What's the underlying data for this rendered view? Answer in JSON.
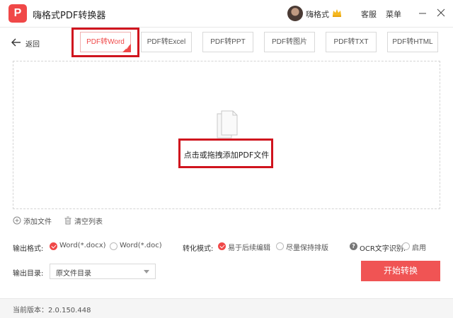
{
  "titlebar": {
    "logo_letter": "P",
    "app_title": "嗨格式PDF转换器",
    "username": "嗨格式",
    "support_label": "客服",
    "menu_label": "菜单",
    "minimize_label": "—",
    "close_label": "✕"
  },
  "nav": {
    "back_label": "返回"
  },
  "tabs": [
    {
      "label": "PDF转Word",
      "active": true
    },
    {
      "label": "PDF转Excel",
      "active": false
    },
    {
      "label": "PDF转PPT",
      "active": false
    },
    {
      "label": "PDF转图片",
      "active": false
    },
    {
      "label": "PDF转TXT",
      "active": false
    },
    {
      "label": "PDF转HTML",
      "active": false
    }
  ],
  "dropzone": {
    "text": "点击或拖拽添加PDF文件"
  },
  "actions": {
    "add_file": "添加文件",
    "clear_list": "清空列表"
  },
  "options": {
    "output_format_label": "输出格式:",
    "format_options": [
      {
        "label": "Word(*.docx)",
        "selected": true
      },
      {
        "label": "Word(*.doc)",
        "selected": false
      }
    ],
    "convert_mode_label": "转化模式:",
    "mode_options": [
      {
        "label": "易于后续编辑",
        "selected": true
      },
      {
        "label": "尽量保持排版",
        "selected": false
      }
    ],
    "ocr_label": "OCR文字识别:",
    "ocr_enable_label": "启用",
    "ocr_enabled": false,
    "output_dir_label": "输出目录:",
    "output_dir_value": "原文件目录"
  },
  "start_button": "开始转换",
  "status": {
    "version": "当前版本：2.0.150.448"
  },
  "colors": {
    "accent": "#f04848",
    "highlight_box": "#d0141e",
    "start_button": "#f05454"
  }
}
